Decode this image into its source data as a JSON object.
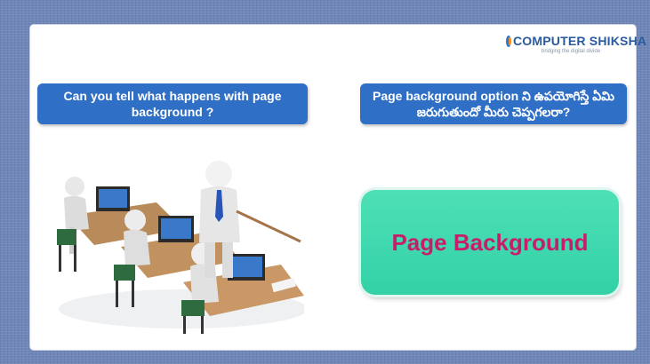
{
  "logo": {
    "brand": "COMPUTER SHIKSHA",
    "tagline": "bridging the digital divide",
    "icon": "computer-shiksha-logo-icon"
  },
  "question_en": "Can you tell what happens with page background ?",
  "question_te": "Page background option ని ఉపయోగిస్తే ఏమి జరుగుతుందో మీరు చెప్పగలరా?",
  "illustration": "classroom-computers-illustration",
  "topic_box": "Page Background",
  "colors": {
    "question_box": "#2f6fc6",
    "topic_box": "#3fd8ae",
    "topic_text": "#c81d6a",
    "frame": "#6f86b8"
  }
}
